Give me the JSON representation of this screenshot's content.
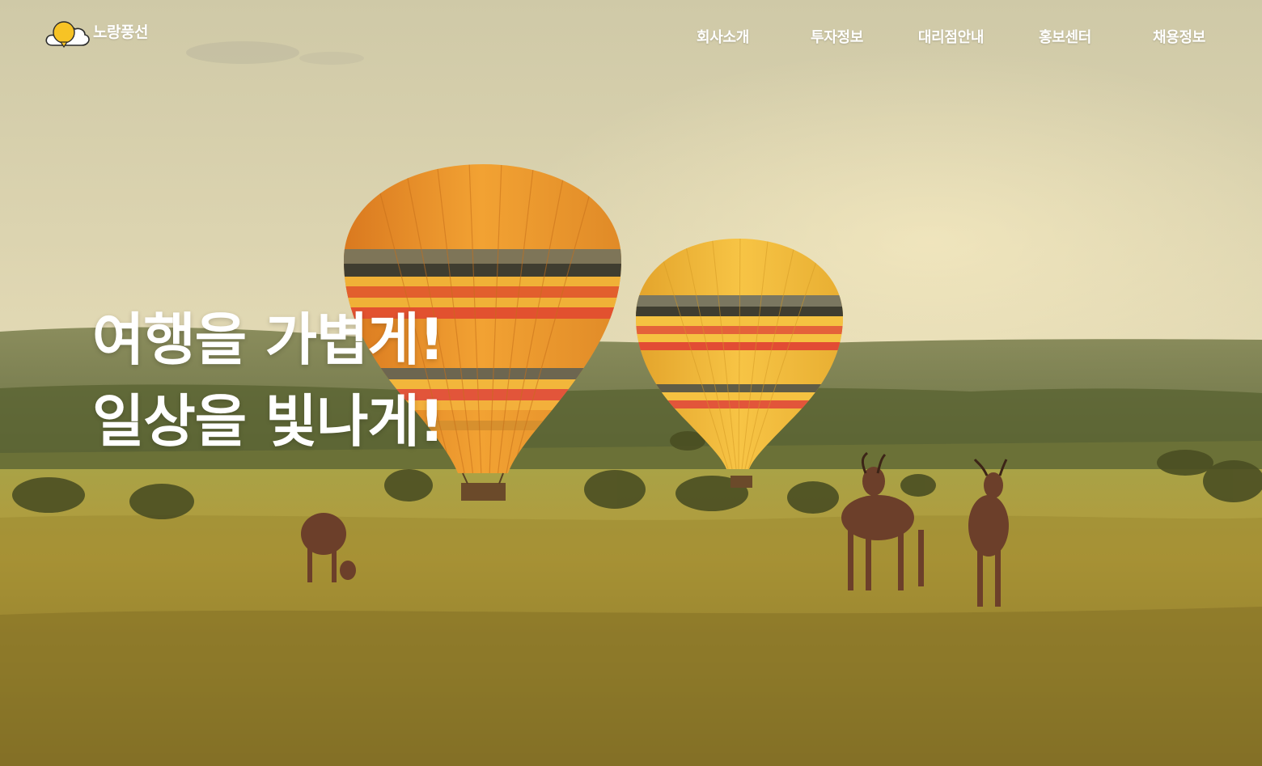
{
  "brand": {
    "name": "노랑풍선",
    "logo_icon": "yellow-balloon-cloud-icon",
    "accent_color": "#f7c325"
  },
  "nav": {
    "items": [
      {
        "label": "회사소개"
      },
      {
        "label": "투자정보"
      },
      {
        "label": "대리점안내"
      },
      {
        "label": "홍보센터"
      },
      {
        "label": "채용정보"
      }
    ]
  },
  "hero": {
    "headline_line1": "여행을 가볍게!",
    "headline_line2": "일상을 빛나게!",
    "image_subject": "hot-air-balloons-over-savanna-with-antelopes"
  }
}
